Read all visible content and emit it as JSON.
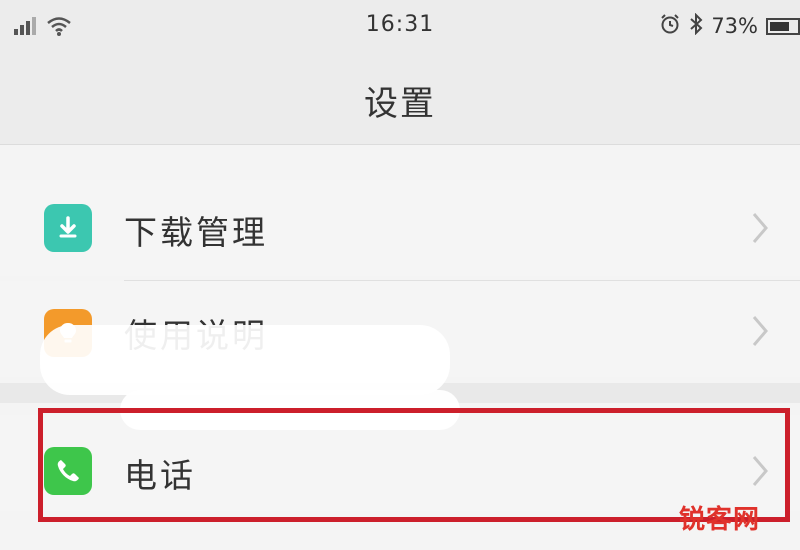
{
  "status_bar": {
    "time": "16:31",
    "battery_percent": "73%",
    "battery_level": 0.73,
    "icons": [
      "signal-icon",
      "wifi-icon",
      "alarm-icon",
      "bluetooth-icon",
      "battery-icon"
    ]
  },
  "nav": {
    "title": "设置"
  },
  "settings_list": {
    "items": [
      {
        "label": "下载管理",
        "icon": "download-icon",
        "icon_color": "#3cc7b0"
      },
      {
        "label": "使用说明",
        "icon": "lightbulb-icon",
        "icon_color": "#f39a2b"
      },
      {
        "label": "电话",
        "icon": "phone-icon",
        "icon_color": "#3ec64b"
      }
    ]
  },
  "highlight_color": "#cc1f2b",
  "watermark": "锐客网"
}
